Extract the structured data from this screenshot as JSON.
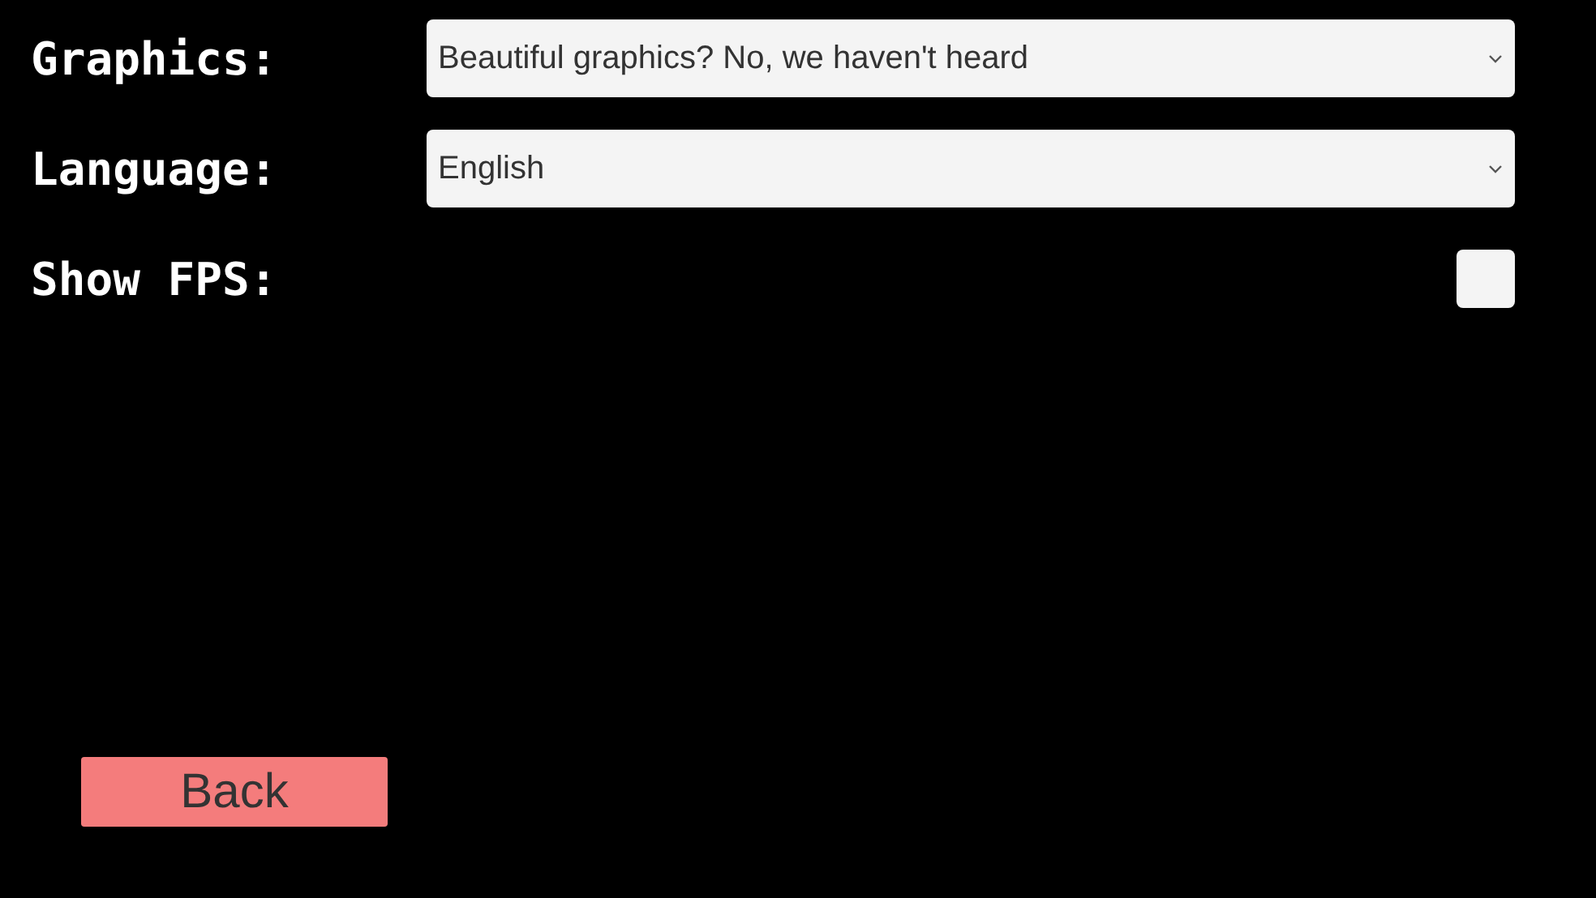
{
  "settings": [
    {
      "kind": "dropdown",
      "label": "Graphics:",
      "value": "Beautiful graphics? No, we haven't heard"
    },
    {
      "kind": "dropdown",
      "label": "Language:",
      "value": "English"
    },
    {
      "kind": "checkbox",
      "label": "Show FPS:",
      "checked": false
    }
  ],
  "back_button": {
    "label": "Back"
  }
}
